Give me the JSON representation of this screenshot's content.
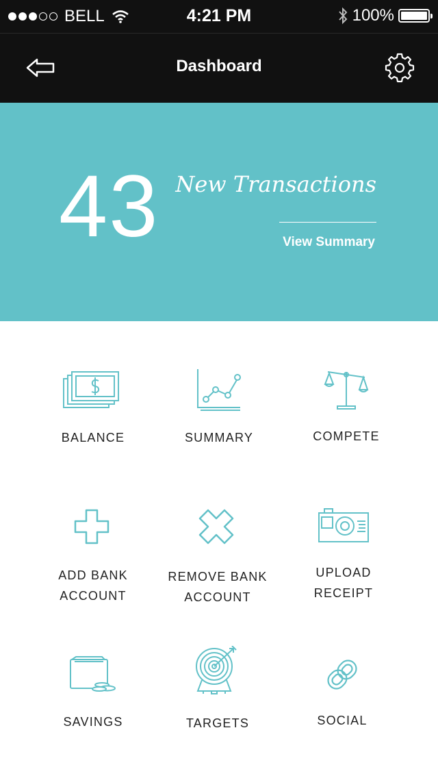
{
  "status": {
    "carrier": "BELL",
    "time": "4:21 PM",
    "battery": "100%"
  },
  "nav": {
    "title": "Dashboard"
  },
  "hero": {
    "count": "43",
    "label": "New Transactions",
    "link": "View Summary"
  },
  "tiles": [
    {
      "label": "BALANCE",
      "icon": "money-icon"
    },
    {
      "label": "SUMMARY",
      "icon": "line-chart-icon"
    },
    {
      "label": "COMPETE",
      "icon": "scales-icon"
    },
    {
      "label": "ADD BANK\nACCOUNT",
      "icon": "plus-icon"
    },
    {
      "label": "REMOVE BANK\nACCOUNT",
      "icon": "cross-icon"
    },
    {
      "label": "UPLOAD\nRECEIPT",
      "icon": "camera-icon"
    },
    {
      "label": "SAVINGS",
      "icon": "wallet-icon"
    },
    {
      "label": "TARGETS",
      "icon": "target-icon"
    },
    {
      "label": "SOCIAL",
      "icon": "chain-link-icon"
    }
  ],
  "colors": {
    "accent": "#62c1c8",
    "bar": "#111111"
  }
}
